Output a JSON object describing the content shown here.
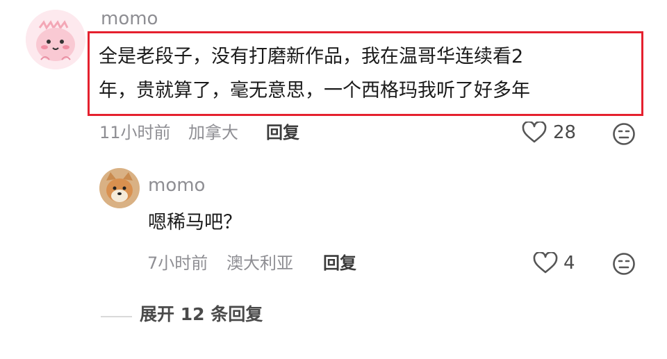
{
  "comment": {
    "username": "momo",
    "text_line1": "全是老段子，没有打磨新作品，我在温哥华连续看2",
    "text_line2": "年，贵就算了，毫无意思，一个西格玛我听了好多年",
    "time": "11小时前",
    "location": "加拿大",
    "reply_label": "回复",
    "likes": "28",
    "highlight_color": "#e5202e"
  },
  "reply": {
    "username": "momo",
    "text": "嗯稀马吧？",
    "time": "7小时前",
    "location": "澳大利亚",
    "reply_label": "回复",
    "likes": "4"
  },
  "expand": {
    "label": "展开 12 条回复"
  },
  "icons": {
    "like": "heart-outline-icon",
    "dislike": "meh-face-icon",
    "avatar_main": "pink-cartoon-avatar",
    "avatar_reply": "shiba-dog-avatar"
  }
}
